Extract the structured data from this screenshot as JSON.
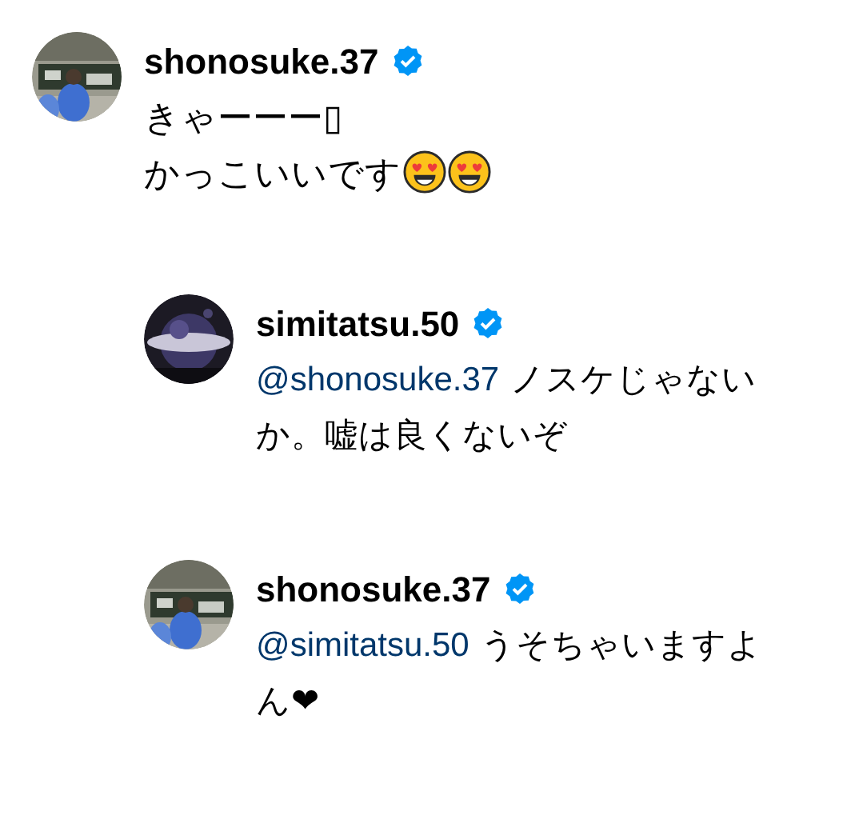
{
  "comments": [
    {
      "username": "shonosuke.37",
      "verified": true,
      "lines": [
        "きゃーーー▯",
        "かっこいいです"
      ],
      "replies": [
        {
          "username": "simitatsu.50",
          "verified": true,
          "mention": "@shonosuke.37",
          "text": "ノスケじゃないか。嘘は良くないぞ"
        },
        {
          "username": "shonosuke.37",
          "verified": true,
          "mention": "@simitatsu.50",
          "text": "うそちゃいますよん❤"
        }
      ]
    }
  ]
}
